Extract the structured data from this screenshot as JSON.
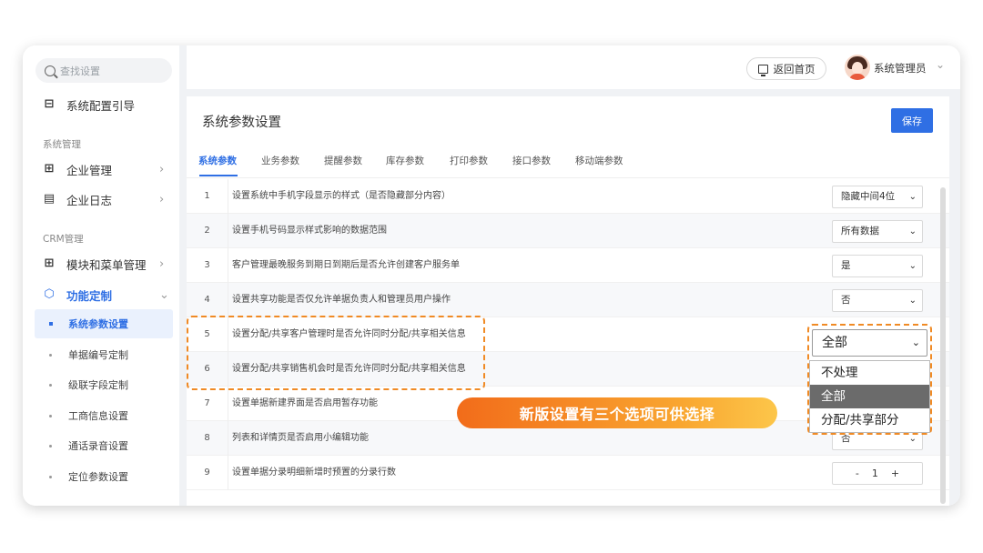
{
  "sidebar": {
    "search_placeholder": "查找设置",
    "guide": "系统配置引导",
    "group_system": "系统管理",
    "enterprise_mgmt": "企业管理",
    "enterprise_log": "企业日志",
    "group_crm": "CRM管理",
    "module_menu": "模块和菜单管理",
    "custom_features": "功能定制",
    "subitems": [
      "系统参数设置",
      "单据编号定制",
      "级联字段定制",
      "工商信息设置",
      "通话录音设置",
      "定位参数设置"
    ]
  },
  "header": {
    "home_label": "返回首页",
    "user_name": "系统管理员"
  },
  "main": {
    "title": "系统参数设置",
    "save_label": "保存",
    "tabs": [
      "系统参数",
      "业务参数",
      "提醒参数",
      "库存参数",
      "打印参数",
      "接口参数",
      "移动端参数"
    ],
    "rows": [
      {
        "num": "1",
        "text": "设置系统中手机字段显示的样式（是否隐藏部分内容）",
        "value": "隐藏中间4位"
      },
      {
        "num": "2",
        "text": "设置手机号码显示样式影响的数据范围",
        "value": "所有数据"
      },
      {
        "num": "3",
        "text": "客户管理最晚服务到期日到期后是否允许创建客户服务单",
        "value": "是"
      },
      {
        "num": "4",
        "text": "设置共享功能是否仅允许单据负责人和管理员用户操作",
        "value": "否"
      },
      {
        "num": "5",
        "text": "设置分配/共享客户管理时是否允许同时分配/共享相关信息",
        "value": "全部"
      },
      {
        "num": "6",
        "text": "设置分配/共享销售机会时是否允许同时分配/共享相关信息",
        "value": ""
      },
      {
        "num": "7",
        "text": "设置单据新建界面是否启用暂存功能",
        "value": ""
      },
      {
        "num": "8",
        "text": "列表和详情页是否启用小编辑功能",
        "value": "否"
      },
      {
        "num": "9",
        "text": "设置单据分录明细新增时预置的分录行数",
        "value": "1"
      }
    ],
    "stepper_minus": "-",
    "stepper_plus": "+"
  },
  "dropdown": {
    "selected": "全部",
    "options": [
      "不处理",
      "全部",
      "分配/共享部分"
    ]
  },
  "banner_text": "新版设置有三个选项可供选择",
  "colors": {
    "accent": "#2f6fe4",
    "highlight": "#f08a24"
  }
}
